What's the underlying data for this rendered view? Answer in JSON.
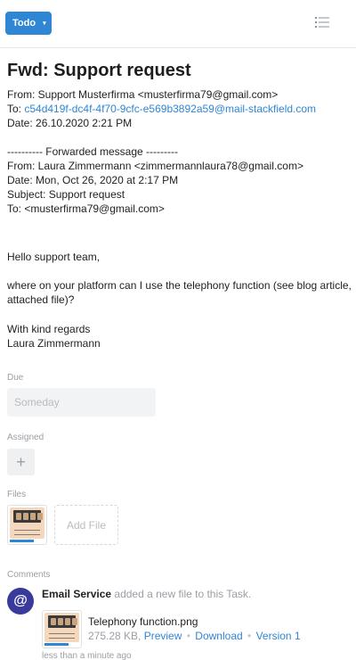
{
  "topbar": {
    "status_label": "Todo",
    "status_caret": "▾",
    "menu_icon": "list-icon"
  },
  "task": {
    "title": "Fwd: Support request",
    "from_line": "From: Support Musterfirma <musterfirma79@gmail.com>",
    "to_prefix": "To: ",
    "to_link": "c54d419f-dc4f-4f70-9cfc-e569b3892a59@mail-stackfield.com",
    "date_line": "Date: 26.10.2020 2:21 PM",
    "fwd_header": "---------- Forwarded message ---------",
    "fwd_from": "From: Laura Zimmermann <zimmermannlaura78@gmail.com>",
    "fwd_date": "Date: Mon, Oct 26, 2020 at 2:17 PM",
    "fwd_subject": "Subject: Support request",
    "fwd_to": "To: <musterfirma79@gmail.com>",
    "greeting": "Hello support team,",
    "question": "where on your platform can I use the telephony function (see blog article, attached file)?",
    "closing": "With kind regards",
    "signature": "Laura Zimmermann"
  },
  "due": {
    "label": "Due",
    "value": "Someday"
  },
  "assigned": {
    "label": "Assigned",
    "add_symbol": "+"
  },
  "files": {
    "label": "Files",
    "add_label": "Add File"
  },
  "comments": {
    "label": "Comments",
    "items": [
      {
        "author": "Email Service",
        "action": " added a new file to this Task.",
        "avatar_symbol": "@",
        "avatar_color": "#3a3a9c",
        "file_name": "Telephony function.png",
        "file_size": "275.28 KB, ",
        "preview": "Preview",
        "download": "Download",
        "version": "Version 1",
        "separator": "•",
        "time": "less than a minute ago"
      }
    ]
  },
  "colors": {
    "accent": "#2f86d4",
    "muted": "#9a9fa5"
  }
}
